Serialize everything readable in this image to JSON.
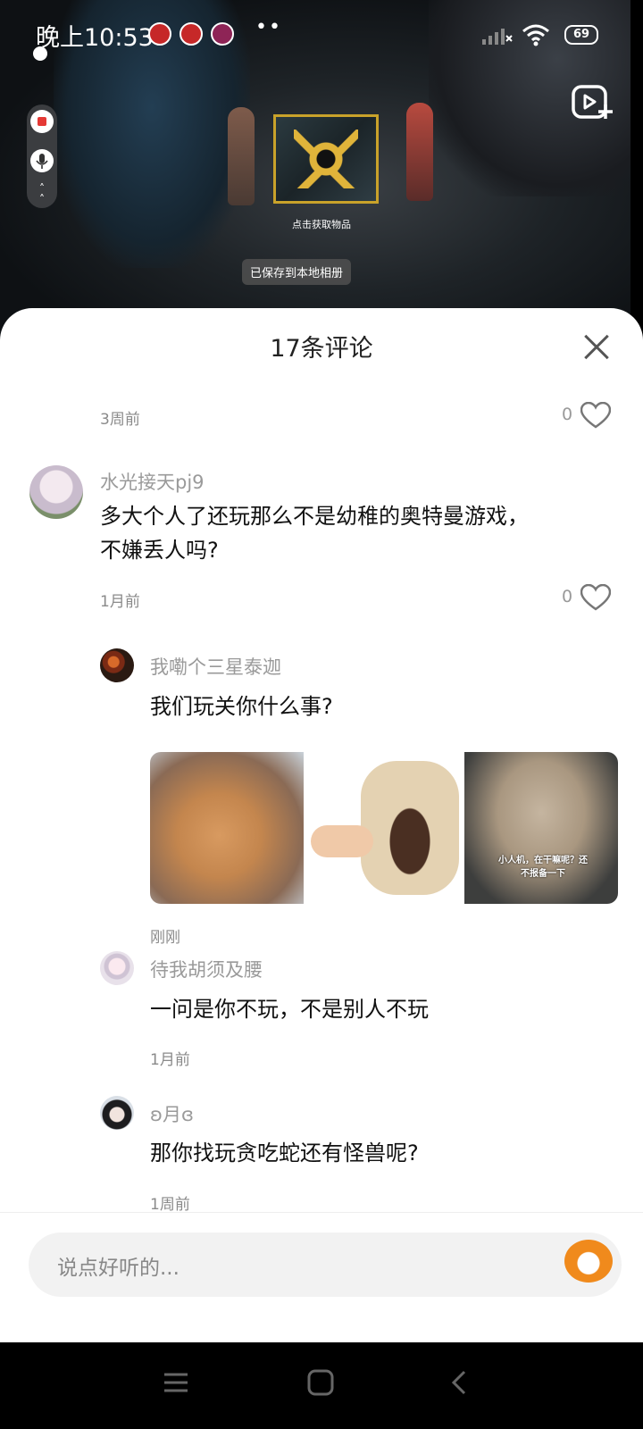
{
  "status_bar": {
    "time": "晚上10:53",
    "battery": "69"
  },
  "video": {
    "tap_label": "点击获取物品",
    "saved_toast": "已保存到本地相册"
  },
  "sheet": {
    "title": "17条评论"
  },
  "comments": [
    {
      "time": "3周前",
      "likes": "0"
    },
    {
      "user": "水光接天pj9",
      "text_line1": "多大个人了还玩那么不是幼稚的奥特曼游戏，",
      "text_line2": "不嫌丢人吗?",
      "time": "1月前",
      "likes": "0"
    },
    {
      "user": "我嘞个三星泰迦",
      "text": "我们玩关你什么事?",
      "time": "刚刚",
      "image_caption_1": "小人机，在干嘛呢？还",
      "image_caption_2": "不报备一下"
    },
    {
      "user": "待我胡须及腰",
      "text": "一问是你不玩，不是别人不玩",
      "time": "1月前"
    },
    {
      "user": "ʚ月ɞ",
      "text": "那你找玩贪吃蛇还有怪兽呢?",
      "time": "1周前"
    }
  ],
  "input": {
    "placeholder": "说点好听的..."
  },
  "colors": {
    "accent": "#f08a1c",
    "record": "#e53935"
  }
}
